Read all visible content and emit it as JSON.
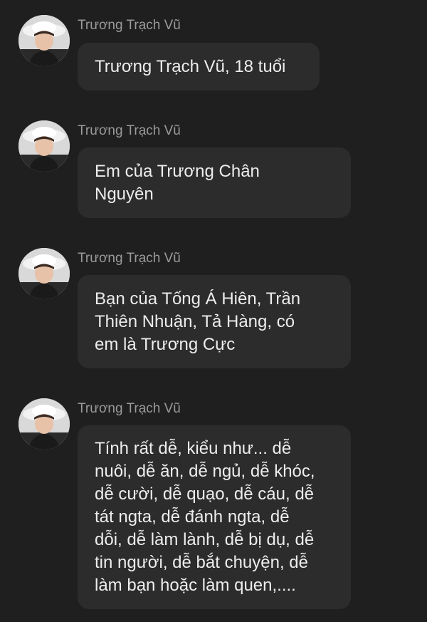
{
  "messages": [
    {
      "sender": "Trương Trạch Vũ",
      "text": "Trương Trạch Vũ, 18 tuổi"
    },
    {
      "sender": "Trương Trạch Vũ",
      "text": "Em của Trương Chân\nNguyên"
    },
    {
      "sender": "Trương Trạch Vũ",
      "text": "Bạn của Tống Á Hiên, Trần\nThiên Nhuận, Tả Hàng, có\nem là Trương Cực"
    },
    {
      "sender": "Trương Trạch Vũ",
      "text": "Tính rất dễ, kiểu như... dễ\nnuôi, dễ ăn, dễ ngủ, dễ khóc,\ndễ cười, dễ quạo, dễ cáu, dễ\ntát ngta, dễ đánh ngta, dễ\ndỗi, dễ làm lành, dễ bị dụ, dễ\ntin người, dễ bắt chuyện, dễ\nlàm bạn hoặc làm quen,...."
    }
  ],
  "icons": {
    "avatar": "profile-photo"
  }
}
